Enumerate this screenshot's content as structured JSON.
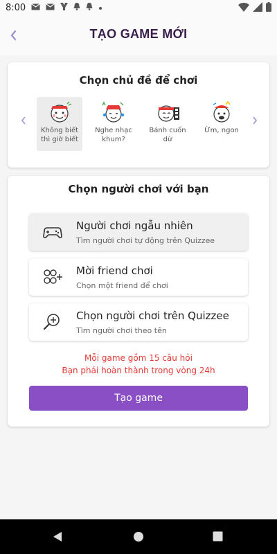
{
  "status_bar": {
    "time": "8:00",
    "left_icons": [
      "gmail-icon",
      "gmail-icon",
      "y-app-icon",
      "bell-icon",
      "bell-icon",
      "dot-icon"
    ],
    "right_icons": [
      "wifi-icon",
      "signal-icon",
      "battery-icon"
    ]
  },
  "header": {
    "title": "TẠO GAME MỚI",
    "back_icon": "chevron-left-icon"
  },
  "topic_section": {
    "title": "Chọn chủ đề để chơi",
    "topics": [
      {
        "label": "Không biết thì giờ biết",
        "selected": true
      },
      {
        "label": "Nghe nhạc khum?",
        "selected": false
      },
      {
        "label": "Bánh cuốn dừ",
        "selected": false
      },
      {
        "label": "Ừm, ngon",
        "selected": false
      }
    ],
    "prev_icon": "chevron-left-icon",
    "next_icon": "chevron-right-icon"
  },
  "player_section": {
    "title": "Chọn người chơi với bạn",
    "options": [
      {
        "icon": "gamepad-icon",
        "title": "Người chơi ngẫu nhiên",
        "subtitle": "Tìm người chơi tự động trên Quizzee"
      },
      {
        "icon": "add-friends-icon",
        "title": "Mời friend chơi",
        "subtitle": "Chọn một friend để chơi"
      },
      {
        "icon": "search-player-icon",
        "title": "Chọn người chơi trên Quizzee",
        "subtitle": "Tìm người chơi theo tên"
      }
    ],
    "notes": [
      "Mỗi game gồm 15 câu hỏi",
      "Bạn phải hoàn thành trong vòng 24h"
    ],
    "create_button": "Tạo game"
  },
  "colors": {
    "accent": "#8a4fc5",
    "title": "#3a1f4d",
    "warning": "#e53935",
    "arrow": "#a79ad6"
  },
  "nav_bar": {
    "icons": [
      "back-triangle-icon",
      "home-circle-icon",
      "recents-square-icon"
    ]
  }
}
